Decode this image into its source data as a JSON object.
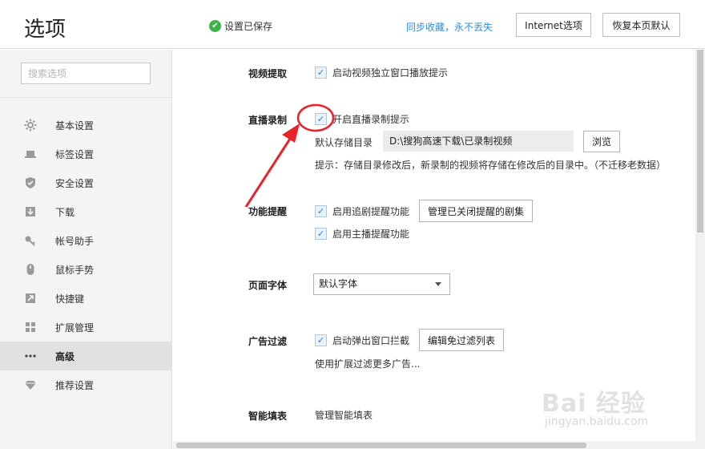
{
  "header": {
    "title": "选项",
    "saved_status": "设置已保存",
    "sync_link": "同步收藏，永不丢失",
    "internet_button": "Internet选项",
    "restore_button": "恢复本页默认"
  },
  "sidebar": {
    "search_placeholder": "搜索选项",
    "items": [
      {
        "label": "基本设置",
        "icon": "gear-icon",
        "active": false
      },
      {
        "label": "标签设置",
        "icon": "laptop-icon",
        "active": false
      },
      {
        "label": "安全设置",
        "icon": "shield-icon",
        "active": false
      },
      {
        "label": "下载",
        "icon": "download-icon",
        "active": false
      },
      {
        "label": "帐号助手",
        "icon": "key-icon",
        "active": false
      },
      {
        "label": "鼠标手势",
        "icon": "mouse-icon",
        "active": false
      },
      {
        "label": "快捷键",
        "icon": "shortcut-icon",
        "active": false
      },
      {
        "label": "扩展管理",
        "icon": "grid-icon",
        "active": false
      },
      {
        "label": "高级",
        "icon": "dots-icon",
        "active": true
      },
      {
        "label": "推荐设置",
        "icon": "diamond-icon",
        "active": false
      }
    ]
  },
  "content": {
    "video_extract": {
      "label": "视频提取",
      "option": "启动视频独立窗口播放提示",
      "checked": true
    },
    "live_record": {
      "label": "直播录制",
      "option": "开启直播录制提示",
      "checked": true,
      "storage_label": "默认存储目录",
      "storage_path": "D:\\搜狗高速下载\\已录制视频",
      "browse_button": "浏览",
      "hint": "提示：存储目录修改后，新录制的视频将存储在修改后的目录中。（不迁移老数据）"
    },
    "reminder": {
      "label": "功能提醒",
      "option1": "启用追剧提醒功能",
      "option1_checked": true,
      "manage_button": "管理已关闭提醒的剧集",
      "option2": "启用主播提醒功能",
      "option2_checked": true
    },
    "font": {
      "label": "页面字体",
      "selected": "默认字体"
    },
    "ad_filter": {
      "label": "广告过滤",
      "option": "启动弹出窗口拦截",
      "checked": true,
      "edit_button": "编辑免过滤列表",
      "more_link": "使用扩展过滤更多广告..."
    },
    "autofill": {
      "label": "智能填表",
      "link": "管理智能填表"
    }
  },
  "watermark": {
    "brand": "Bai 经验",
    "url": "jingyan.baidu.com"
  },
  "colors": {
    "accent_link": "#2d8fe0",
    "saved_ok": "#3cb44a",
    "annotation_red": "#e8232a",
    "active_nav_bg": "#e1e1e1"
  }
}
